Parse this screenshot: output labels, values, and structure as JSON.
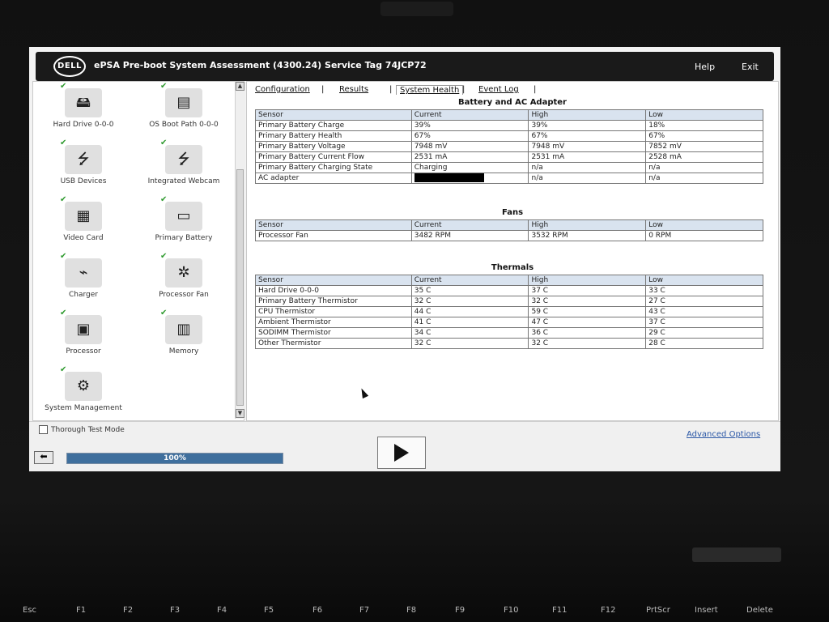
{
  "header": {
    "title": "ePSA Pre-boot System Assessment (4300.24)   Service Tag 74JCP72",
    "logo_text": "DELL",
    "help_label": "Help",
    "exit_label": "Exit"
  },
  "devices": [
    {
      "label": "Hard Drive 0-0-0",
      "icon": "hard-drive-icon",
      "checked": true
    },
    {
      "label": "OS Boot Path 0-0-0",
      "icon": "boot-path-icon",
      "checked": true
    },
    {
      "label": "USB Devices",
      "icon": "usb-icon",
      "checked": true
    },
    {
      "label": "Integrated Webcam",
      "icon": "webcam-icon",
      "checked": true
    },
    {
      "label": "Video Card",
      "icon": "video-card-icon",
      "checked": true
    },
    {
      "label": "Primary Battery",
      "icon": "battery-icon",
      "checked": true
    },
    {
      "label": "Charger",
      "icon": "charger-icon",
      "checked": true
    },
    {
      "label": "Processor Fan",
      "icon": "fan-icon",
      "checked": true
    },
    {
      "label": "Processor",
      "icon": "processor-icon",
      "checked": true
    },
    {
      "label": "Memory",
      "icon": "memory-icon",
      "checked": true
    },
    {
      "label": "System Management",
      "icon": "system-management-icon",
      "checked": true
    }
  ],
  "tabs": [
    {
      "label": "Configuration"
    },
    {
      "label": "Results"
    },
    {
      "label": "System Health",
      "active": true
    },
    {
      "label": "Event Log"
    }
  ],
  "battery": {
    "title": "Battery and AC Adapter",
    "headers": [
      "Sensor",
      "Current",
      "High",
      "Low"
    ],
    "rows": [
      [
        "Primary Battery Charge",
        "39%",
        "39%",
        "18%"
      ],
      [
        "Primary Battery Health",
        "67%",
        "67%",
        "67%"
      ],
      [
        "Primary Battery Voltage",
        "7948 mV",
        "7948 mV",
        "7852 mV"
      ],
      [
        "Primary Battery Current Flow",
        "2531 mA",
        "2531 mA",
        "2528 mA"
      ],
      [
        "Primary Battery Charging State",
        "Charging",
        "n/a",
        "n/a"
      ],
      [
        "AC adapter",
        "",
        "n/a",
        "n/a"
      ]
    ]
  },
  "fans": {
    "title": "Fans",
    "headers": [
      "Sensor",
      "Current",
      "High",
      "Low"
    ],
    "rows": [
      [
        "Processor Fan",
        "3482 RPM",
        "3532 RPM",
        "0 RPM"
      ]
    ]
  },
  "thermals": {
    "title": "Thermals",
    "headers": [
      "Sensor",
      "Current",
      "High",
      "Low"
    ],
    "rows": [
      [
        "Hard Drive 0-0-0",
        "35 C",
        "37 C",
        "33 C"
      ],
      [
        "Primary Battery Thermistor",
        "32 C",
        "32 C",
        "27 C"
      ],
      [
        "CPU Thermistor",
        "44 C",
        "59 C",
        "43 C"
      ],
      [
        "Ambient Thermistor",
        "41 C",
        "47 C",
        "37 C"
      ],
      [
        "SODIMM Thermistor",
        "34 C",
        "36 C",
        "29 C"
      ],
      [
        "Other Thermistor",
        "32 C",
        "32 C",
        "28 C"
      ]
    ]
  },
  "footer": {
    "thorough_label": "Thorough Test Mode",
    "advanced_label": "Advanced Options",
    "progress_text": "100%",
    "progress_value": 1.0
  },
  "keyboard": [
    "Esc",
    "F1",
    "F2",
    "F3",
    "F4",
    "F5",
    "F6",
    "F7",
    "F8",
    "F9",
    "F10",
    "F11",
    "F12",
    "PrtScr",
    "Insert",
    "Delete"
  ],
  "colors": {
    "accent": "#3f6f9d",
    "header_row": "#d9e3ef",
    "check": "#2e9a2e"
  }
}
